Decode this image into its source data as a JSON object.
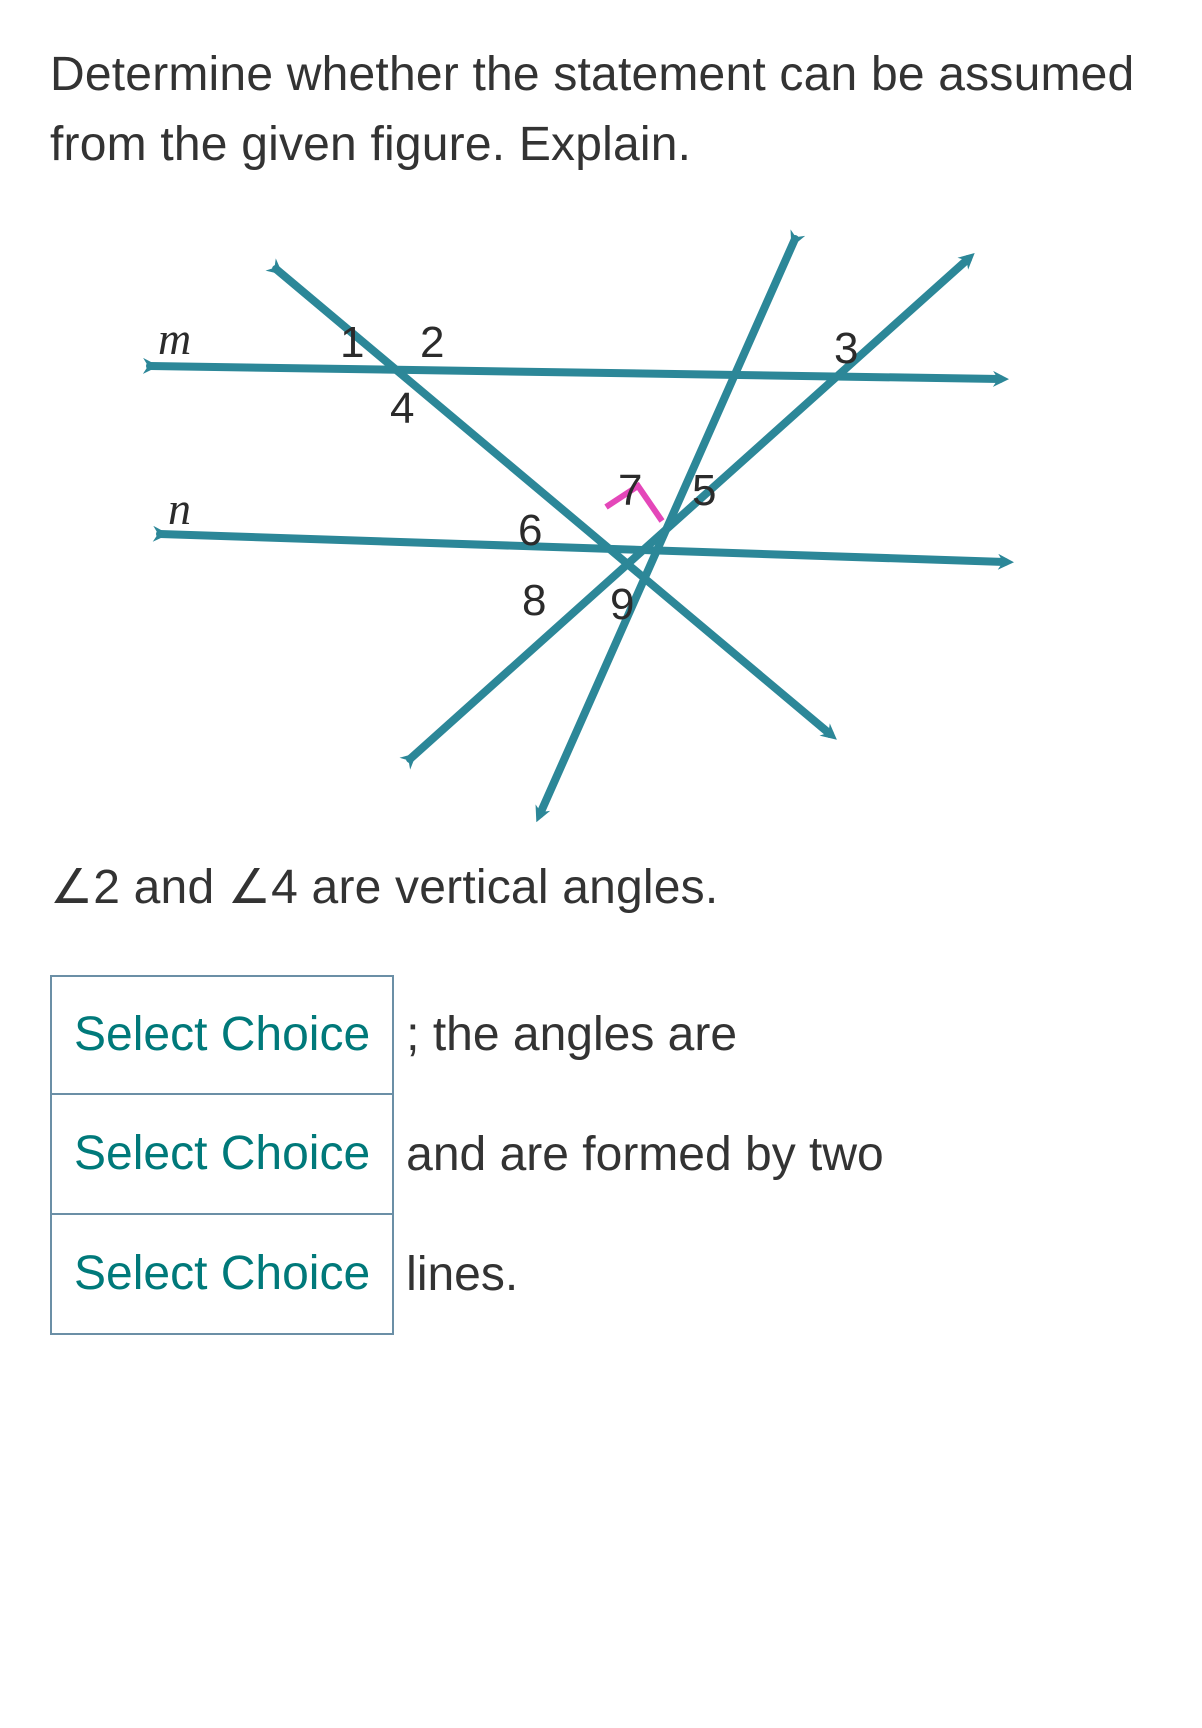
{
  "prompt": "Determine whether the statement can be assumed from the given figure. Explain.",
  "statement_prefix": "∠2 and ∠4 are vertical angles.",
  "figure": {
    "line_labels": {
      "m": "m",
      "n": "n"
    },
    "angle_labels": {
      "a1": "1",
      "a2": "2",
      "a3": "3",
      "a4": "4",
      "a5": "5",
      "a6": "6",
      "a7": "7",
      "a8": "8",
      "a9": "9"
    }
  },
  "answer": {
    "choice_placeholder": "Select Choice",
    "text1": "; the angles are",
    "text2": "and are formed by two",
    "text3": "lines."
  },
  "chart_data": {
    "type": "diagram",
    "description": "Two horizontal-ish lines m and n crossed by several transversals. Intersection on line m has angles 1,2,4 (and 3 at a second intersection to the right). Intersection on line n has angles 5,6,7,8,9 with angle 7 marked as a right angle (pink square).",
    "points": {
      "P_m": "intersection on line m forming angles 1,2,4",
      "Q_m": "second intersection on line m forming angle 3",
      "R_n": "intersection on line n forming angles 5,6,7,8,9"
    },
    "angles_at_P_m": [
      "1",
      "2",
      "4"
    ],
    "angles_at_Q_m": [
      "3"
    ],
    "angles_at_R_n": [
      "5",
      "6",
      "7",
      "8",
      "9"
    ],
    "right_angle": "7",
    "statement_under_test": "∠2 and ∠4 are vertical angles."
  }
}
